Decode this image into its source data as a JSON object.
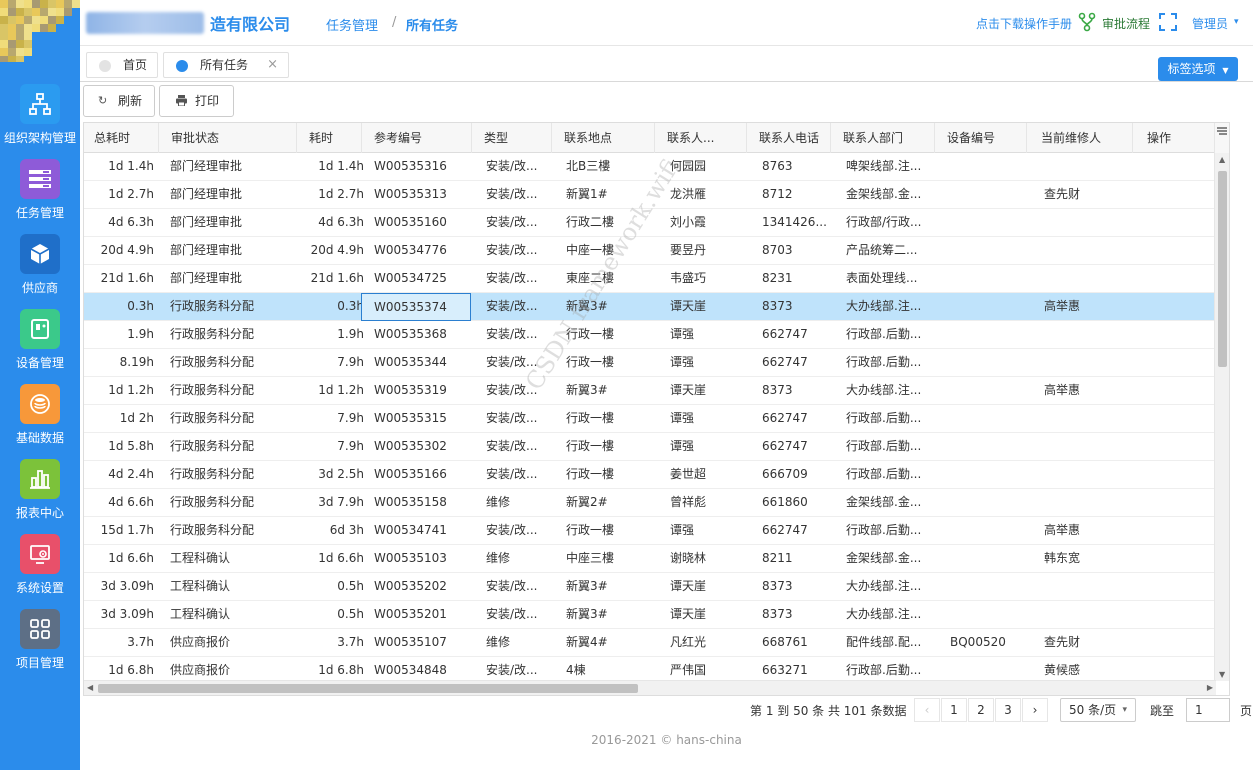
{
  "header": {
    "company": "造有限公司",
    "crumb_parent": "任务管理",
    "crumb_current": "所有任务",
    "manual_link": "点击下载操作手册",
    "approval_flow": "审批流程",
    "user_menu": "管理员"
  },
  "sidebar": {
    "items": [
      {
        "label": "组织架构管理",
        "color": "#2b9bf0"
      },
      {
        "label": "任务管理",
        "color": "#8e5bd8"
      },
      {
        "label": "供应商",
        "color": "#1f6fc9"
      },
      {
        "label": "设备管理",
        "color": "#3bc98a"
      },
      {
        "label": "基础数据",
        "color": "#f7983a"
      },
      {
        "label": "报表中心",
        "color": "#7cc23a"
      },
      {
        "label": "系统设置",
        "color": "#e8506a"
      },
      {
        "label": "项目管理",
        "color": "#5d6f86"
      }
    ]
  },
  "tabs": {
    "home": "首页",
    "all_tasks": "所有任务",
    "close": "×",
    "tag_options": "标签选项"
  },
  "toolbar": {
    "refresh": "刷新",
    "print": "打印"
  },
  "table": {
    "columns": [
      "总耗时",
      "审批状态",
      "耗时",
      "参考编号",
      "类型",
      "联系地点",
      "联系人...",
      "联系人电话",
      "联系人部门",
      "设备编号",
      "当前维修人",
      "操作"
    ],
    "rows": [
      [
        "1d 1.4h",
        "部门经理审批",
        "1d 1.4h",
        "W00535316",
        "安装/改...",
        "北B三樓",
        "何园园",
        "8763",
        "啤架线部.注...",
        "",
        ""
      ],
      [
        "1d 2.7h",
        "部门经理审批",
        "1d 2.7h",
        "W00535313",
        "安装/改...",
        "新翼1#",
        "龙洪雁",
        "8712",
        "金架线部.金...",
        "",
        "查先财"
      ],
      [
        "4d 6.3h",
        "部门经理审批",
        "4d 6.3h",
        "W00535160",
        "安装/改...",
        "行政二樓",
        "刘小霞",
        "1341426...",
        "行政部/行政...",
        "",
        ""
      ],
      [
        "20d 4.9h",
        "部门经理审批",
        "20d 4.9h",
        "W00534776",
        "安装/改...",
        "中座一樓",
        "要昱丹",
        "8703",
        "产品统筹二...",
        "",
        ""
      ],
      [
        "21d 1.6h",
        "部门经理审批",
        "21d 1.6h",
        "W00534725",
        "安装/改...",
        "東座二樓",
        "韦盛巧",
        "8231",
        "表面处理线...",
        "",
        ""
      ],
      [
        "0.3h",
        "行政服务科分配",
        "0.3h",
        "W00535374",
        "安装/改...",
        "新翼3#",
        "谭天崖",
        "8373",
        "大办线部.注...",
        "",
        "高举惠"
      ],
      [
        "1.9h",
        "行政服务科分配",
        "1.9h",
        "W00535368",
        "安装/改...",
        "行政一樓",
        "谭强",
        "662747",
        "行政部.后勤...",
        "",
        ""
      ],
      [
        "8.19h",
        "行政服务科分配",
        "7.9h",
        "W00535344",
        "安装/改...",
        "行政一樓",
        "谭强",
        "662747",
        "行政部.后勤...",
        "",
        ""
      ],
      [
        "1d 1.2h",
        "行政服务科分配",
        "1d 1.2h",
        "W00535319",
        "安装/改...",
        "新翼3#",
        "谭天崖",
        "8373",
        "大办线部.注...",
        "",
        "高举惠"
      ],
      [
        "1d 2h",
        "行政服务科分配",
        "7.9h",
        "W00535315",
        "安装/改...",
        "行政一樓",
        "谭强",
        "662747",
        "行政部.后勤...",
        "",
        ""
      ],
      [
        "1d 5.8h",
        "行政服务科分配",
        "7.9h",
        "W00535302",
        "安装/改...",
        "行政一樓",
        "谭强",
        "662747",
        "行政部.后勤...",
        "",
        ""
      ],
      [
        "4d 2.4h",
        "行政服务科分配",
        "3d 2.5h",
        "W00535166",
        "安装/改...",
        "行政一樓",
        "姜世超",
        "666709",
        "行政部.后勤...",
        "",
        ""
      ],
      [
        "4d 6.6h",
        "行政服务科分配",
        "3d 7.9h",
        "W00535158",
        "维修",
        "新翼2#",
        "曾祥彪",
        "661860",
        "金架线部.金...",
        "",
        ""
      ],
      [
        "15d 1.7h",
        "行政服务科分配",
        "6d 3h",
        "W00534741",
        "安装/改...",
        "行政一樓",
        "谭强",
        "662747",
        "行政部.后勤...",
        "",
        "高举惠"
      ],
      [
        "1d 6.6h",
        "工程科确认",
        "1d 6.6h",
        "W00535103",
        "维修",
        "中座三樓",
        "谢晓林",
        "8211",
        "金架线部.金...",
        "",
        "韩东宽"
      ],
      [
        "3d 3.09h",
        "工程科确认",
        "0.5h",
        "W00535202",
        "安装/改...",
        "新翼3#",
        "谭天崖",
        "8373",
        "大办线部.注...",
        "",
        ""
      ],
      [
        "3d 3.09h",
        "工程科确认",
        "0.5h",
        "W00535201",
        "安装/改...",
        "新翼3#",
        "谭天崖",
        "8373",
        "大办线部.注...",
        "",
        ""
      ],
      [
        "3.7h",
        "供应商报价",
        "3.7h",
        "W00535107",
        "维修",
        "新翼4#",
        "凡红光",
        "668761",
        "配件线部.配...",
        "BQ00520",
        "查先财"
      ],
      [
        "1d 6.8h",
        "供应商报价",
        "1d 6.8h",
        "W00534848",
        "安装/改...",
        "4棟",
        "严伟国",
        "663271",
        "行政部.后勤...",
        "",
        "黄候感"
      ]
    ]
  },
  "pagination": {
    "info": "第 1 到 50 条 共 101 条数据",
    "prev": "‹",
    "next": "›",
    "pages": [
      "1",
      "2",
      "3"
    ],
    "page_size": "50 条/页",
    "jump_label": "跳至",
    "jump_value": "1",
    "page_suffix": "页"
  },
  "footer": "2016-2021 © hans-china",
  "watermark": "CSDN framework.wifi"
}
